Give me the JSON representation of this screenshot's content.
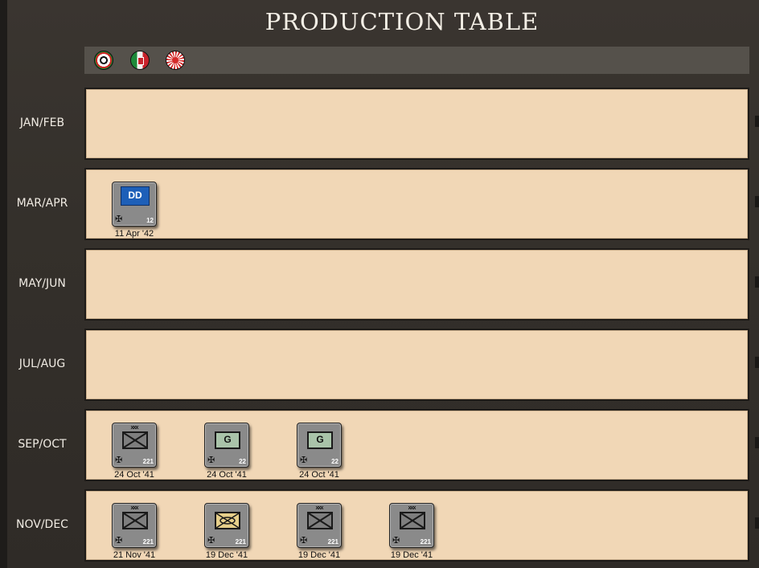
{
  "title": "PRODUCTION TABLE",
  "nations": [
    {
      "name": "german-flag-icon"
    },
    {
      "name": "italian-flag-icon"
    },
    {
      "name": "japanese-flag-icon"
    }
  ],
  "rows": [
    {
      "label": "JAN/FEB",
      "units": []
    },
    {
      "label": "MAR/APR",
      "units": [
        {
          "type": "ship",
          "symbol": "DD",
          "value": "12",
          "date": "11 Apr '42"
        }
      ]
    },
    {
      "label": "MAY/JUN",
      "units": []
    },
    {
      "label": "JUL/AUG",
      "units": []
    },
    {
      "label": "SEP/OCT",
      "units": [
        {
          "type": "infantry",
          "size": "xxx",
          "value": "221",
          "date": "24 Oct '41"
        },
        {
          "type": "garrison",
          "symbol": "G",
          "value": "22",
          "date": "24 Oct '41"
        },
        {
          "type": "garrison",
          "symbol": "G",
          "value": "22",
          "date": "24 Oct '41"
        }
      ]
    },
    {
      "label": "NOV/DEC",
      "units": [
        {
          "type": "infantry",
          "size": "xxx",
          "value": "221",
          "date": "21 Nov '41"
        },
        {
          "type": "supply",
          "value": "221",
          "date": "19 Dec '41"
        },
        {
          "type": "infantry",
          "size": "xxx",
          "value": "221",
          "date": "19 Dec '41"
        },
        {
          "type": "infantry",
          "size": "xxx",
          "value": "221",
          "date": "19 Dec '41"
        }
      ]
    }
  ],
  "colors": {
    "panel": "#f1d7b6",
    "counter": "#8a8a8a",
    "garrison": "#a9c3a9",
    "ship": "#1d5fb8"
  }
}
